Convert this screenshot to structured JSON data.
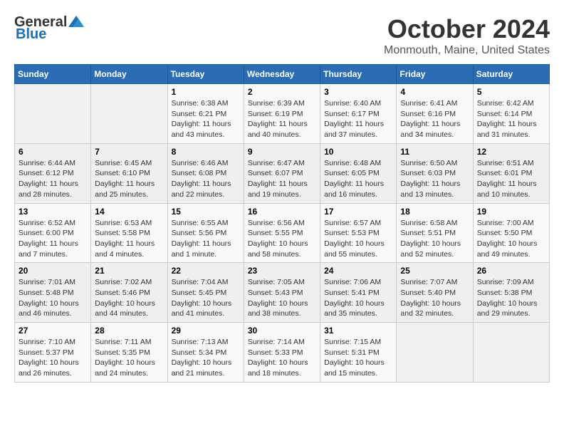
{
  "header": {
    "logo_general": "General",
    "logo_blue": "Blue",
    "title": "October 2024",
    "subtitle": "Monmouth, Maine, United States"
  },
  "weekdays": [
    "Sunday",
    "Monday",
    "Tuesday",
    "Wednesday",
    "Thursday",
    "Friday",
    "Saturday"
  ],
  "weeks": [
    [
      {
        "day": "",
        "info": ""
      },
      {
        "day": "",
        "info": ""
      },
      {
        "day": "1",
        "info": "Sunrise: 6:38 AM\nSunset: 6:21 PM\nDaylight: 11 hours and 43 minutes."
      },
      {
        "day": "2",
        "info": "Sunrise: 6:39 AM\nSunset: 6:19 PM\nDaylight: 11 hours and 40 minutes."
      },
      {
        "day": "3",
        "info": "Sunrise: 6:40 AM\nSunset: 6:17 PM\nDaylight: 11 hours and 37 minutes."
      },
      {
        "day": "4",
        "info": "Sunrise: 6:41 AM\nSunset: 6:16 PM\nDaylight: 11 hours and 34 minutes."
      },
      {
        "day": "5",
        "info": "Sunrise: 6:42 AM\nSunset: 6:14 PM\nDaylight: 11 hours and 31 minutes."
      }
    ],
    [
      {
        "day": "6",
        "info": "Sunrise: 6:44 AM\nSunset: 6:12 PM\nDaylight: 11 hours and 28 minutes."
      },
      {
        "day": "7",
        "info": "Sunrise: 6:45 AM\nSunset: 6:10 PM\nDaylight: 11 hours and 25 minutes."
      },
      {
        "day": "8",
        "info": "Sunrise: 6:46 AM\nSunset: 6:08 PM\nDaylight: 11 hours and 22 minutes."
      },
      {
        "day": "9",
        "info": "Sunrise: 6:47 AM\nSunset: 6:07 PM\nDaylight: 11 hours and 19 minutes."
      },
      {
        "day": "10",
        "info": "Sunrise: 6:48 AM\nSunset: 6:05 PM\nDaylight: 11 hours and 16 minutes."
      },
      {
        "day": "11",
        "info": "Sunrise: 6:50 AM\nSunset: 6:03 PM\nDaylight: 11 hours and 13 minutes."
      },
      {
        "day": "12",
        "info": "Sunrise: 6:51 AM\nSunset: 6:01 PM\nDaylight: 11 hours and 10 minutes."
      }
    ],
    [
      {
        "day": "13",
        "info": "Sunrise: 6:52 AM\nSunset: 6:00 PM\nDaylight: 11 hours and 7 minutes."
      },
      {
        "day": "14",
        "info": "Sunrise: 6:53 AM\nSunset: 5:58 PM\nDaylight: 11 hours and 4 minutes."
      },
      {
        "day": "15",
        "info": "Sunrise: 6:55 AM\nSunset: 5:56 PM\nDaylight: 11 hours and 1 minute."
      },
      {
        "day": "16",
        "info": "Sunrise: 6:56 AM\nSunset: 5:55 PM\nDaylight: 10 hours and 58 minutes."
      },
      {
        "day": "17",
        "info": "Sunrise: 6:57 AM\nSunset: 5:53 PM\nDaylight: 10 hours and 55 minutes."
      },
      {
        "day": "18",
        "info": "Sunrise: 6:58 AM\nSunset: 5:51 PM\nDaylight: 10 hours and 52 minutes."
      },
      {
        "day": "19",
        "info": "Sunrise: 7:00 AM\nSunset: 5:50 PM\nDaylight: 10 hours and 49 minutes."
      }
    ],
    [
      {
        "day": "20",
        "info": "Sunrise: 7:01 AM\nSunset: 5:48 PM\nDaylight: 10 hours and 46 minutes."
      },
      {
        "day": "21",
        "info": "Sunrise: 7:02 AM\nSunset: 5:46 PM\nDaylight: 10 hours and 44 minutes."
      },
      {
        "day": "22",
        "info": "Sunrise: 7:04 AM\nSunset: 5:45 PM\nDaylight: 10 hours and 41 minutes."
      },
      {
        "day": "23",
        "info": "Sunrise: 7:05 AM\nSunset: 5:43 PM\nDaylight: 10 hours and 38 minutes."
      },
      {
        "day": "24",
        "info": "Sunrise: 7:06 AM\nSunset: 5:41 PM\nDaylight: 10 hours and 35 minutes."
      },
      {
        "day": "25",
        "info": "Sunrise: 7:07 AM\nSunset: 5:40 PM\nDaylight: 10 hours and 32 minutes."
      },
      {
        "day": "26",
        "info": "Sunrise: 7:09 AM\nSunset: 5:38 PM\nDaylight: 10 hours and 29 minutes."
      }
    ],
    [
      {
        "day": "27",
        "info": "Sunrise: 7:10 AM\nSunset: 5:37 PM\nDaylight: 10 hours and 26 minutes."
      },
      {
        "day": "28",
        "info": "Sunrise: 7:11 AM\nSunset: 5:35 PM\nDaylight: 10 hours and 24 minutes."
      },
      {
        "day": "29",
        "info": "Sunrise: 7:13 AM\nSunset: 5:34 PM\nDaylight: 10 hours and 21 minutes."
      },
      {
        "day": "30",
        "info": "Sunrise: 7:14 AM\nSunset: 5:33 PM\nDaylight: 10 hours and 18 minutes."
      },
      {
        "day": "31",
        "info": "Sunrise: 7:15 AM\nSunset: 5:31 PM\nDaylight: 10 hours and 15 minutes."
      },
      {
        "day": "",
        "info": ""
      },
      {
        "day": "",
        "info": ""
      }
    ]
  ]
}
